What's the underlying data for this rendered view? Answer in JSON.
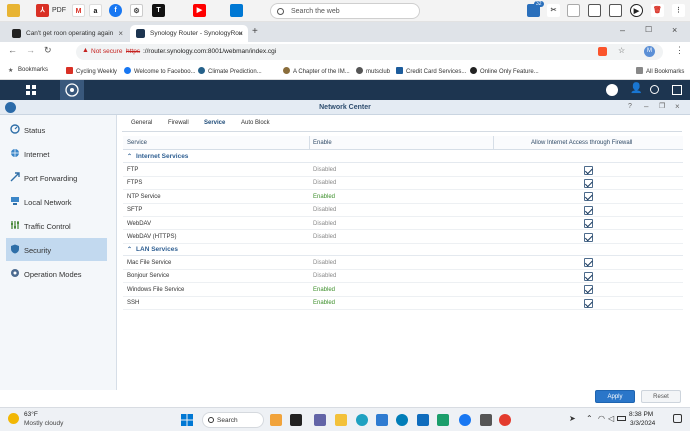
{
  "top_bar": {
    "pdf_label": "PDF",
    "search_placeholder": "Search the web",
    "badge_count": "32"
  },
  "tabs": [
    {
      "title": "Can't get roon operating again"
    },
    {
      "title": "Synology Router - SynologyRou"
    }
  ],
  "address": {
    "security": "Not secure",
    "url_scheme": "https",
    "url_rest": "://router.synology.com:8001/webman/index.cgi",
    "profile_initial": "M"
  },
  "bookmarks": {
    "items": [
      "Bookmarks",
      "Cycling Weekly",
      "Welcome to Faceboo...",
      "Climate Prediction...",
      "A Chapter of the IM...",
      "mutsclub",
      "Credit Card Services...",
      "Online Only Feature..."
    ],
    "all_label": "All Bookmarks"
  },
  "window": {
    "title": "Network Center"
  },
  "sidebar": {
    "items": [
      {
        "label": "Status"
      },
      {
        "label": "Internet"
      },
      {
        "label": "Port Forwarding"
      },
      {
        "label": "Local Network"
      },
      {
        "label": "Traffic Control"
      },
      {
        "label": "Security"
      },
      {
        "label": "Operation Modes"
      }
    ]
  },
  "content_tabs": [
    "General",
    "Firewall",
    "Service",
    "Auto Block"
  ],
  "table": {
    "headers": {
      "service": "Service",
      "enable": "Enable",
      "allow": "Allow Internet Access through Firewall"
    },
    "internet_section": "Internet Services",
    "internet_rows": [
      {
        "service": "FTP",
        "enable": "Disabled",
        "allowed": true
      },
      {
        "service": "FTPS",
        "enable": "Disabled",
        "allowed": true
      },
      {
        "service": "NTP Service",
        "enable": "Enabled",
        "allowed": true
      },
      {
        "service": "SFTP",
        "enable": "Disabled",
        "allowed": true
      },
      {
        "service": "WebDAV",
        "enable": "Disabled",
        "allowed": true
      },
      {
        "service": "WebDAV (HTTPS)",
        "enable": "Disabled",
        "allowed": true
      }
    ],
    "lan_section": "LAN Services",
    "lan_rows": [
      {
        "service": "Mac File Service",
        "enable": "Disabled",
        "allowed": true
      },
      {
        "service": "Bonjour Service",
        "enable": "Disabled",
        "allowed": true
      },
      {
        "service": "Windows File Service",
        "enable": "Enabled",
        "allowed": true
      },
      {
        "service": "SSH",
        "enable": "Enabled",
        "allowed": true
      }
    ]
  },
  "buttons": {
    "apply": "Apply",
    "reset": "Reset"
  },
  "taskbar": {
    "weather_temp": "63°F",
    "weather_desc": "Mostly cloudy",
    "search_label": "Search",
    "time": "8:38 PM",
    "date": "3/3/2024"
  }
}
